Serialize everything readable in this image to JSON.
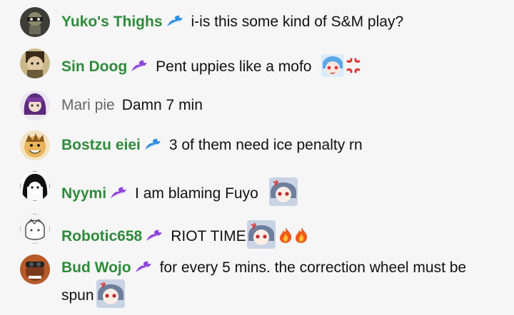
{
  "messages": [
    {
      "author": "Yuko's Thighs",
      "member": true,
      "badge": "blue-wave-badge",
      "text": "i-is this some kind of S&M play?",
      "emotes": []
    },
    {
      "author": "Sin Doog",
      "member": true,
      "badge": "purple-wave-badge",
      "text": "Pent uppies like a mofo",
      "emotes": [
        "chibi-emote",
        "anger-emote"
      ]
    },
    {
      "author": "Mari pie",
      "member": false,
      "badge": null,
      "text": "Damn 7 min",
      "emotes": []
    },
    {
      "author": "Bostzu eiei",
      "member": true,
      "badge": "blue-wave-badge",
      "text": "3 of them need ice penalty rn",
      "emotes": []
    },
    {
      "author": "Nyymi",
      "member": true,
      "badge": "purple-wave-badge",
      "text": "I am blaming Fuyo",
      "emotes": [
        "fuyo-emote"
      ]
    },
    {
      "author": "Robotic658",
      "member": true,
      "badge": "purple-wave-badge",
      "text": "RIOT TIME",
      "emotes": [
        "fuyo-emote",
        "fire-emote",
        "fire-emote"
      ]
    },
    {
      "author": "Bud Wojo",
      "member": true,
      "badge": "purple-wave-badge",
      "text": "for every 5 mins. the correction wheel must be spun",
      "emotes": [
        "fuyo-emote"
      ]
    }
  ],
  "colors": {
    "member_name": "#2e8b3a",
    "guest_name": "#666666",
    "background": "#f6f6f6",
    "blue_badge": "#2f8de4",
    "purple_badge": "#8e44d9"
  }
}
